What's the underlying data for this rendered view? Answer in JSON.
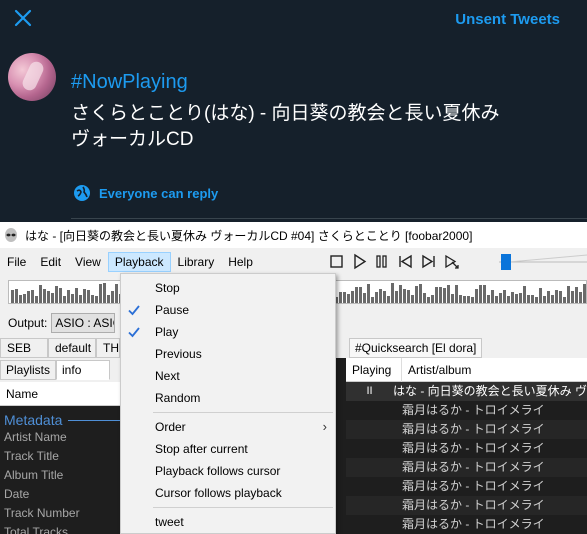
{
  "twitter": {
    "unsent_label": "Unsent Tweets",
    "hashtag": "#NowPlaying",
    "line1": "さくらとことり(はな) - 向日葵の教会と長い夏休み",
    "line2": "ヴォーカルCD",
    "reply_label": "Everyone can reply",
    "accent": "#1d9bf0",
    "background": "#15202b"
  },
  "foobar": {
    "window_title": "はな - [向日葵の教会と長い夏休み ヴォーカルCD #04] さくらとことり  [foobar2000]",
    "menus": [
      "File",
      "Edit",
      "View",
      "Playback",
      "Library",
      "Help"
    ],
    "active_menu": "Playback",
    "output_label": "Output:",
    "output_value": "ASIO : ASIO",
    "tabs": [
      "SEB",
      "default",
      "TH"
    ],
    "quicksearch_tab": "#Quicksearch [El dora]",
    "left_tabs": [
      "Playlists",
      "info"
    ],
    "left_column_header": "Name",
    "metadata_title": "Metadata",
    "metadata_fields": [
      "Artist Name",
      "Track Title",
      "Album Title",
      "Date",
      "Track Number",
      "Total Tracks"
    ],
    "playlist_columns": [
      "Playing",
      "Artist/album"
    ],
    "playlist_rows": [
      {
        "playing": "II",
        "text": "はな - 向日葵の教会と長い夏休み ヴ",
        "current": true
      },
      {
        "playing": "",
        "text": "霜月はるか - トロイメライ",
        "current": false
      },
      {
        "playing": "",
        "text": "霜月はるか - トロイメライ",
        "current": false
      },
      {
        "playing": "",
        "text": "霜月はるか - トロイメライ",
        "current": false
      },
      {
        "playing": "",
        "text": "霜月はるか - トロイメライ",
        "current": false
      },
      {
        "playing": "",
        "text": "霜月はるか - トロイメライ",
        "current": false
      },
      {
        "playing": "",
        "text": "霜月はるか - トロイメライ",
        "current": false
      },
      {
        "playing": "",
        "text": "霜月はるか - トロイメライ",
        "current": false
      }
    ]
  },
  "playback_menu": {
    "items": [
      {
        "label": "Stop",
        "checked": false,
        "submenu": false
      },
      {
        "label": "Pause",
        "checked": true,
        "submenu": false
      },
      {
        "label": "Play",
        "checked": true,
        "submenu": false
      },
      {
        "label": "Previous",
        "checked": false,
        "submenu": false
      },
      {
        "label": "Next",
        "checked": false,
        "submenu": false
      },
      {
        "label": "Random",
        "checked": false,
        "submenu": false
      },
      {
        "label": "Order",
        "checked": false,
        "submenu": true
      },
      {
        "label": "Stop after current",
        "checked": false,
        "submenu": false
      },
      {
        "label": "Playback follows cursor",
        "checked": false,
        "submenu": false
      },
      {
        "label": "Cursor follows playback",
        "checked": false,
        "submenu": false
      },
      {
        "label": "tweet",
        "checked": false,
        "submenu": false
      }
    ],
    "check_color": "#2b6fd6"
  }
}
